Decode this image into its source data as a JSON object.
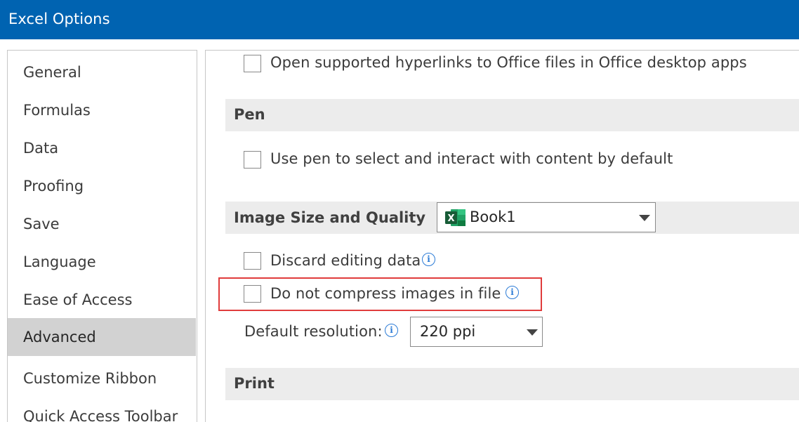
{
  "window": {
    "title": "Excel Options"
  },
  "sidebar": {
    "items": [
      {
        "label": "General",
        "selected": false
      },
      {
        "label": "Formulas",
        "selected": false
      },
      {
        "label": "Data",
        "selected": false
      },
      {
        "label": "Proofing",
        "selected": false
      },
      {
        "label": "Save",
        "selected": false
      },
      {
        "label": "Language",
        "selected": false
      },
      {
        "label": "Ease of Access",
        "selected": false
      },
      {
        "label": "Advanced",
        "selected": true
      },
      {
        "label": "Customize Ribbon",
        "selected": false
      },
      {
        "label": "Quick Access Toolbar",
        "selected": false
      }
    ]
  },
  "content": {
    "hyperlinks_option": {
      "label": "Open supported hyperlinks to Office files in Office desktop apps",
      "checked": false
    },
    "pen_section": {
      "title": "Pen"
    },
    "pen_option": {
      "label": "Use pen to select and interact with content by default",
      "checked": false
    },
    "image_section": {
      "title": "Image Size and Quality",
      "workbook_dropdown": {
        "value": "Book1",
        "icon": "excel-file-icon"
      }
    },
    "discard_option": {
      "label": "Discard editing data",
      "checked": false,
      "info_icon": "info-icon"
    },
    "compress_option": {
      "label": "Do not compress images in file",
      "checked": false,
      "info_icon": "info-icon",
      "highlight_color": "#e03c3c"
    },
    "resolution": {
      "label": "Default resolution:",
      "value": "220 ppi",
      "info_icon": "info-icon"
    },
    "print_section": {
      "title": "Print"
    }
  },
  "colors": {
    "titlebar": "#0063b1",
    "selected_nav": "#d2d2d2",
    "section_header": "#ececec",
    "info_icon": "#2b7bd6",
    "excel_green": "#1f7244"
  }
}
